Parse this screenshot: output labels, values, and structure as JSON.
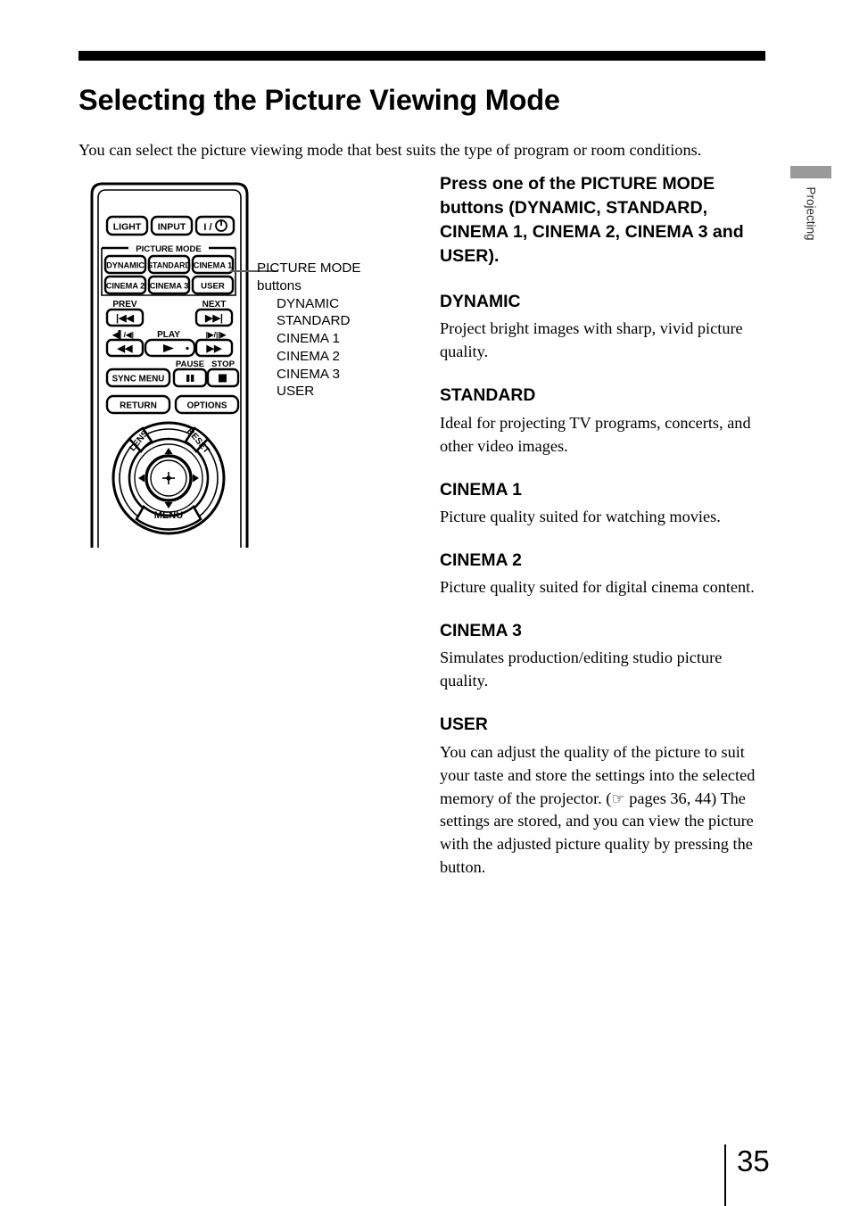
{
  "document": {
    "title": "Selecting the Picture Viewing Mode",
    "intro": "You can select the picture viewing mode that best suits the type of program or room conditions.",
    "page_number": "35",
    "side_tab_label": "Projecting"
  },
  "callout": {
    "heading": "PICTURE MODE",
    "subheading": "buttons",
    "items": [
      "DYNAMIC",
      "STANDARD",
      "CINEMA 1",
      "CINEMA 2",
      "CINEMA 3",
      "USER"
    ]
  },
  "instruction": "Press one of the PICTURE MODE buttons (DYNAMIC, STANDARD, CINEMA 1, CINEMA 2, CINEMA 3 and USER).",
  "modes": [
    {
      "name": "DYNAMIC",
      "description": "Project bright images with sharp, vivid picture quality."
    },
    {
      "name": "STANDARD",
      "description": "Ideal for projecting TV programs, concerts, and other video images."
    },
    {
      "name": "CINEMA 1",
      "description": "Picture quality suited for watching movies."
    },
    {
      "name": "CINEMA 2",
      "description": "Picture quality suited for digital cinema content."
    },
    {
      "name": "CINEMA 3",
      "description": "Simulates production/editing studio picture quality."
    },
    {
      "name": "USER",
      "description_part1": "You can adjust the quality of the picture to suit your taste and store the settings into the selected memory of the projector. (",
      "reference_glyph": "☞",
      "description_part2": " pages 36, 44) The settings are stored, and you can view the picture with the adjusted picture quality by pressing the button."
    }
  ],
  "remote": {
    "group_label": "PICTURE MODE",
    "top_row": [
      "LIGHT",
      "INPUT",
      "I / ⏻"
    ],
    "picture_mode_buttons": [
      "DYNAMIC",
      "STANDARD",
      "CINEMA 1",
      "CINEMA 2",
      "CINEMA 3",
      "USER"
    ],
    "transport_labels": {
      "prev": "PREV",
      "next": "NEXT",
      "play": "PLAY",
      "pause": "PAUSE",
      "stop": "STOP",
      "rew_small": "◀▌/◀|",
      "ff_small": "|▶/||▶"
    },
    "transport_buttons": {
      "prev_glyph": "|◀◀",
      "next_glyph": "▶▶|",
      "rew_glyph": "◀◀",
      "ff_glyph": "▶▶",
      "play_glyph": "▶",
      "pause_glyph": "||",
      "stop_glyph": "■"
    },
    "function_buttons": [
      "SYNC MENU",
      "RETURN",
      "OPTIONS"
    ],
    "pad_labels": {
      "lens": "LENS",
      "reset": "RESET",
      "menu": "MENU"
    }
  },
  "colors": {
    "rule": "#000000",
    "side_tab": "#9a9a9a",
    "leader_line": "#5a5a5a"
  }
}
